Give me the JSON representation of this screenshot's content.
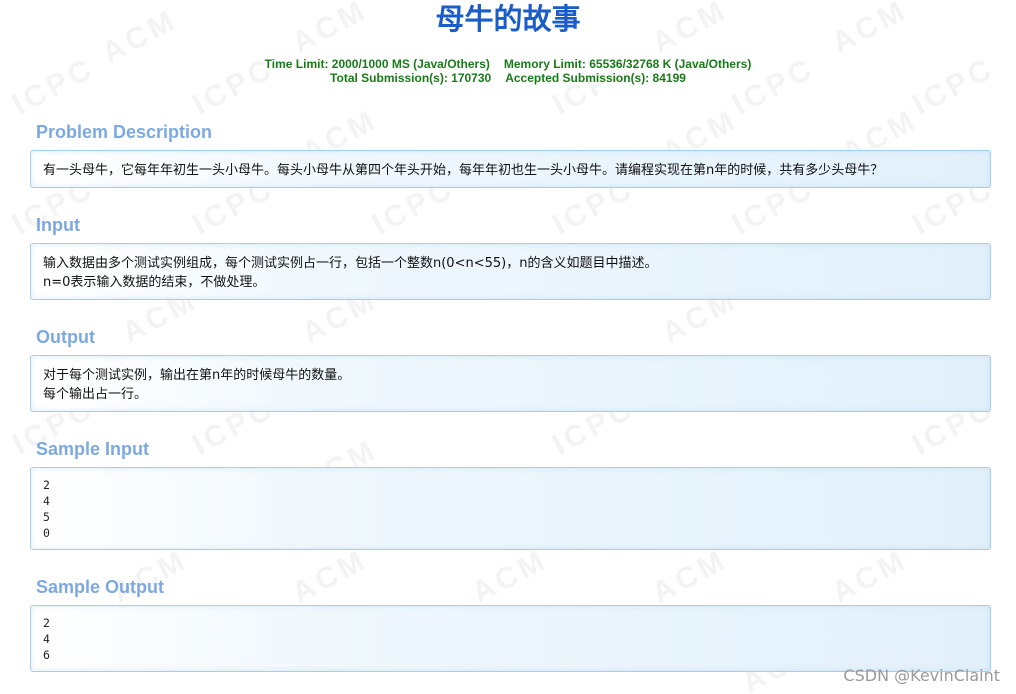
{
  "problem": {
    "title": "母牛的故事",
    "time_limit": "Time Limit: 2000/1000 MS (Java/Others)",
    "memory_limit": "Memory Limit: 65536/32768 K (Java/Others)",
    "total_submissions": "Total Submission(s): 170730",
    "accepted_submissions": "Accepted Submission(s): 84199"
  },
  "sections": {
    "description": {
      "heading": "Problem Description",
      "lines": [
        "有一头母牛，它每年年初生一头小母牛。每头小母牛从第四个年头开始，每年年初也生一头小母牛。请编程实现在第n年的时候，共有多少头母牛？"
      ]
    },
    "input": {
      "heading": "Input",
      "lines": [
        "输入数据由多个测试实例组成，每个测试实例占一行，包括一个整数n(0<n<55)，n的含义如题目中描述。",
        "n=0表示输入数据的结束，不做处理。"
      ]
    },
    "output": {
      "heading": "Output",
      "lines": [
        "对于每个测试实例，输出在第n年的时候母牛的数量。",
        "每个输出占一行。"
      ]
    },
    "sample_input": {
      "heading": "Sample Input",
      "lines": [
        "2",
        "4",
        "5",
        "0"
      ]
    },
    "sample_output": {
      "heading": "Sample Output",
      "lines": [
        "2",
        "4",
        "6"
      ]
    }
  },
  "watermark": {
    "texts": [
      "ACM",
      "ICPC"
    ]
  },
  "credit": "CSDN @KevinClaint",
  "colors": {
    "title": "#1a5cc8",
    "limits": "#1a7a1a",
    "section_heading": "#7ca9e0",
    "panel_border": "#9fd0ee"
  }
}
